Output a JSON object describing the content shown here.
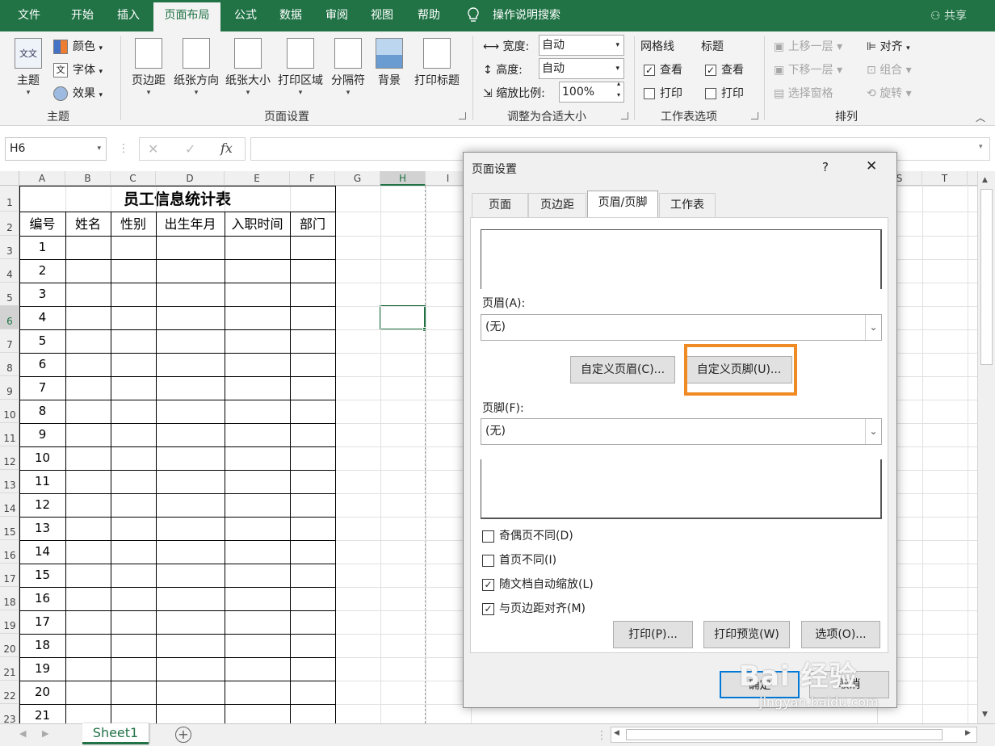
{
  "tabs": [
    "文件",
    "开始",
    "插入",
    "页面布局",
    "公式",
    "数据",
    "审阅",
    "视图",
    "帮助"
  ],
  "active_tab": "页面布局",
  "tell_me": "操作说明搜索",
  "share": "共享",
  "ribbon": {
    "theme": {
      "main": "主题",
      "colors": "颜色",
      "fonts": "字体",
      "effects": "效果",
      "group": "主题"
    },
    "page_setup": {
      "margins": "页边距",
      "orientation": "纸张方向",
      "size": "纸张大小",
      "print_area": "打印区域",
      "breaks": "分隔符",
      "background": "背景",
      "print_titles": "打印标题",
      "group": "页面设置"
    },
    "scale": {
      "width_label": "宽度:",
      "width_value": "自动",
      "height_label": "高度:",
      "height_value": "自动",
      "scale_label": "缩放比例:",
      "scale_value": "100%",
      "group": "调整为合适大小"
    },
    "sheet_options": {
      "gridlines": "网格线",
      "headings": "标题",
      "view": "查看",
      "print": "打印",
      "group": "工作表选项"
    },
    "arrange": {
      "bring_forward": "上移一层",
      "send_backward": "下移一层",
      "selection_pane": "选择窗格",
      "align": "对齐",
      "group": "组合",
      "rotate": "旋转",
      "group_label": "排列"
    }
  },
  "formula_bar": {
    "name_box": "H6",
    "fx": "fx",
    "value": ""
  },
  "columns": [
    "A",
    "B",
    "C",
    "D",
    "E",
    "F",
    "G",
    "H",
    "I",
    "S",
    "T"
  ],
  "rows": [
    "1",
    "2",
    "3",
    "4",
    "5",
    "6",
    "7",
    "8",
    "9",
    "10",
    "11",
    "12",
    "13",
    "14",
    "15",
    "16",
    "17",
    "18",
    "19",
    "20",
    "21",
    "22",
    "23"
  ],
  "table": {
    "title": "员工信息统计表",
    "headers": [
      "编号",
      "姓名",
      "性别",
      "出生年月",
      "入职时间",
      "部门"
    ],
    "ids": [
      "1",
      "2",
      "3",
      "4",
      "5",
      "6",
      "7",
      "8",
      "9",
      "10",
      "11",
      "12",
      "13",
      "14",
      "15",
      "16",
      "17",
      "18",
      "19",
      "20",
      "21"
    ]
  },
  "sheet_tab": "Sheet1",
  "dialog": {
    "title": "页面设置",
    "help": "?",
    "close": "✕",
    "tabs": [
      "页面",
      "页边距",
      "页眉/页脚",
      "工作表"
    ],
    "active_tab": "页眉/页脚",
    "header_label": "页眉(A):",
    "header_value": "(无)",
    "custom_header": "自定义页眉(C)...",
    "custom_footer": "自定义页脚(U)...",
    "footer_label": "页脚(F):",
    "footer_value": "(无)",
    "options": [
      {
        "label": "奇偶页不同(D)",
        "checked": false
      },
      {
        "label": "首页不同(I)",
        "checked": false
      },
      {
        "label": "随文档自动缩放(L)",
        "checked": true
      },
      {
        "label": "与页边距对齐(M)",
        "checked": true
      }
    ],
    "print": "打印(P)...",
    "print_preview": "打印预览(W)",
    "options_btn": "选项(O)...",
    "ok": "确定",
    "cancel": "取消"
  },
  "watermark": {
    "brand": "Bai 经验",
    "url": "jingyan.baidu.com"
  },
  "colors": {
    "excel_green": "#217346",
    "highlight": "#f08a24"
  }
}
